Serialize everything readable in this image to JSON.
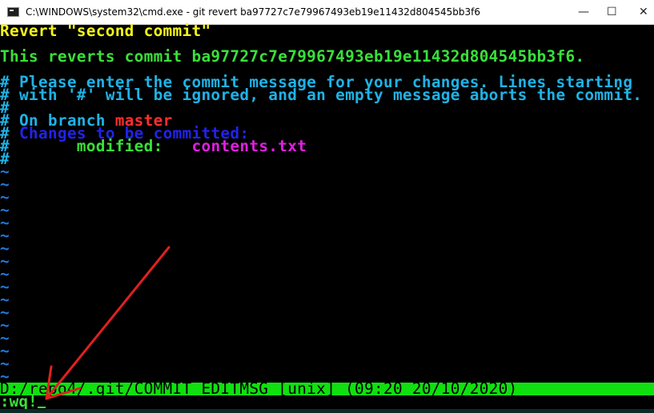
{
  "window": {
    "title": "C:\\WINDOWS\\system32\\cmd.exe - git  revert ba97727c7e79967493eb19e11432d804545bb3f6",
    "minimize_glyph": "—",
    "maximize_glyph": "☐",
    "close_glyph": "✕"
  },
  "editor": {
    "line1": "Revert \"second commit\"",
    "line3": "This reverts commit ba97727c7e79967493eb19e11432d804545bb3f6.",
    "comment1": "# Please enter the commit message for your changes. Lines starting",
    "comment2": "# with '#' will be ignored, and an empty message aborts the commit.",
    "hash_only": "#",
    "branch_prefix": "# On branch ",
    "branch_name": "master",
    "changes_hash": "#",
    "changes_text": " Changes to be committed:",
    "modified_hash": "#",
    "modified_label": "       modified:   ",
    "modified_file": "contents.txt",
    "end_hash": "#",
    "tilde": "~"
  },
  "status": {
    "text": "D:/repo4/.git/COMMIT_EDITMSG [unix] (09:20 20/10/2020)"
  },
  "command": {
    "text": ":wq!"
  },
  "colors": {
    "yellow": "#f5f519",
    "green": "#39e039",
    "cyan": "#1fb2e6",
    "red": "#ff2d2d",
    "blue": "#2222ee",
    "magenta": "#e020e0",
    "status_bg": "#10e010",
    "annotation_arrow": "#e02020"
  }
}
